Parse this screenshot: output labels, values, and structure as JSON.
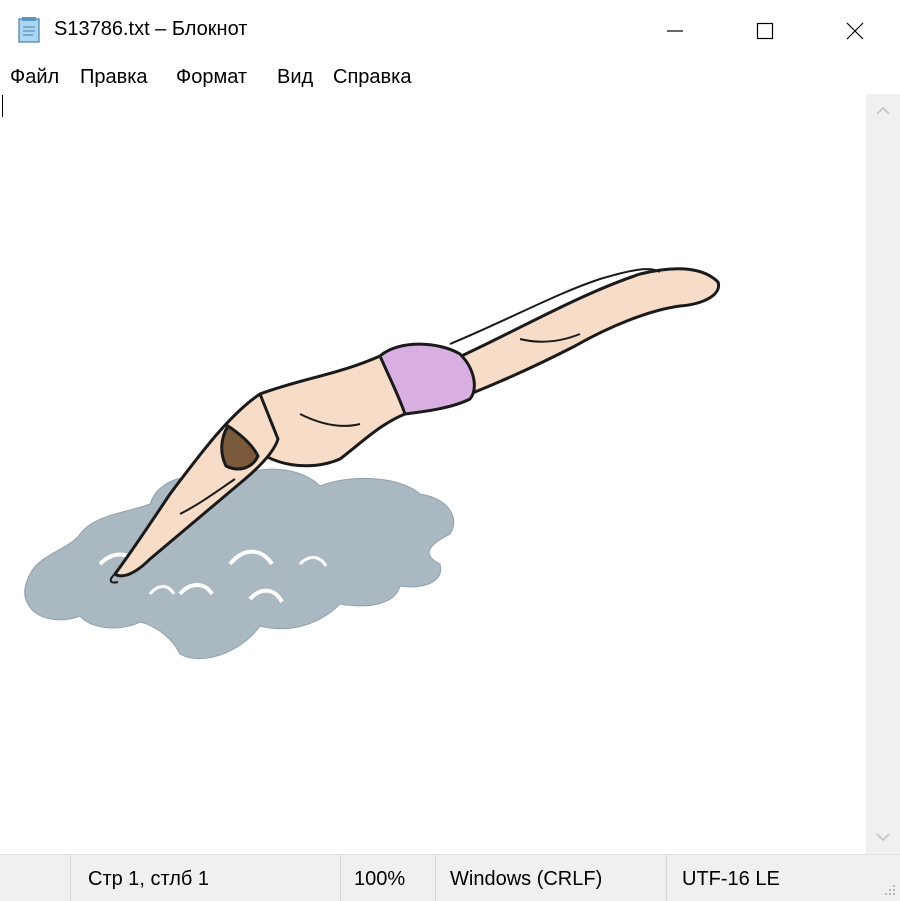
{
  "window": {
    "title": "S13786.txt – Блокнот",
    "icon": "notepad-icon",
    "controls": [
      "minimize-icon",
      "maximize-icon",
      "close-icon"
    ]
  },
  "menu": {
    "file": "Файл",
    "edit": "Правка",
    "format": "Формат",
    "view": "Вид",
    "help": "Справка"
  },
  "editor": {
    "content_text": "",
    "image_subject": "diver"
  },
  "scrollbar": {
    "up_icon": "chevron-up-icon",
    "down_icon": "chevron-down-icon"
  },
  "status": {
    "position": "Стр 1, стлб 1",
    "zoom": "100%",
    "line_endings": "Windows (CRLF)",
    "encoding": "UTF-16 LE"
  },
  "colors": {
    "water": "#aab8c2",
    "skin": "#f7dcc8",
    "trunks": "#d9aee0",
    "outline": "#1a1a1a",
    "hair": "#7a5a3a"
  }
}
